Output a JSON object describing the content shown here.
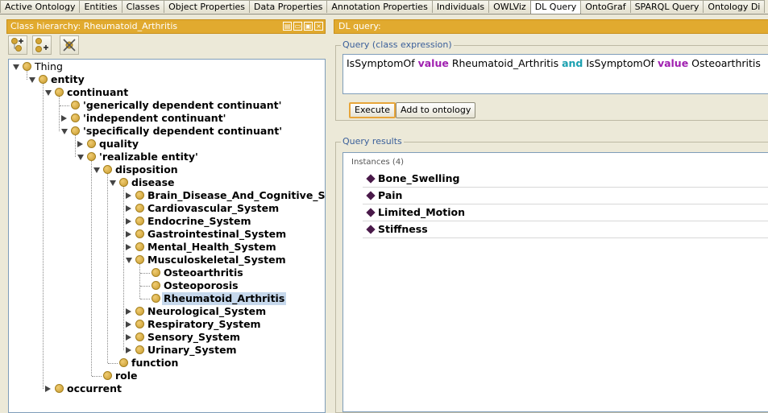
{
  "tabs": [
    {
      "label": "Active Ontology",
      "active": false
    },
    {
      "label": "Entities",
      "active": false
    },
    {
      "label": "Classes",
      "active": false
    },
    {
      "label": "Object Properties",
      "active": false
    },
    {
      "label": "Data Properties",
      "active": false
    },
    {
      "label": "Annotation Properties",
      "active": false
    },
    {
      "label": "Individuals",
      "active": false
    },
    {
      "label": "OWLViz",
      "active": false
    },
    {
      "label": "DL Query",
      "active": true
    },
    {
      "label": "OntoGraf",
      "active": false
    },
    {
      "label": "SPARQL Query",
      "active": false
    },
    {
      "label": "Ontology Di",
      "active": false
    }
  ],
  "class_hierarchy": {
    "title": "Class hierarchy: Rheumatoid_Arthritis",
    "toolbar": [
      {
        "name": "add-subclass-button",
        "icon": "add-subclass-icon"
      },
      {
        "name": "add-sibling-button",
        "icon": "add-sibling-icon"
      },
      {
        "name": "delete-class-button",
        "icon": "delete-class-icon"
      }
    ],
    "nodes": [
      {
        "label": "Thing",
        "depth": 0,
        "state": "open",
        "bold": false
      },
      {
        "label": "entity",
        "depth": 1,
        "state": "open",
        "bold": true
      },
      {
        "label": "continuant",
        "depth": 2,
        "state": "open",
        "bold": true
      },
      {
        "label": "'generically dependent continuant'",
        "depth": 3,
        "state": "leaf",
        "bold": true
      },
      {
        "label": "'independent continuant'",
        "depth": 3,
        "state": "closed",
        "bold": true
      },
      {
        "label": "'specifically dependent continuant'",
        "depth": 3,
        "state": "open",
        "bold": true
      },
      {
        "label": "quality",
        "depth": 4,
        "state": "closed",
        "bold": true
      },
      {
        "label": "'realizable entity'",
        "depth": 4,
        "state": "open",
        "bold": true
      },
      {
        "label": "disposition",
        "depth": 5,
        "state": "open",
        "bold": true
      },
      {
        "label": "disease",
        "depth": 6,
        "state": "open",
        "bold": true
      },
      {
        "label": "Brain_Disease_And_Cognitive_S",
        "depth": 7,
        "state": "closed",
        "bold": true
      },
      {
        "label": "Cardiovascular_System",
        "depth": 7,
        "state": "closed",
        "bold": true
      },
      {
        "label": "Endocrine_System",
        "depth": 7,
        "state": "closed",
        "bold": true
      },
      {
        "label": "Gastrointestinal_System",
        "depth": 7,
        "state": "closed",
        "bold": true
      },
      {
        "label": "Mental_Health_System",
        "depth": 7,
        "state": "closed",
        "bold": true
      },
      {
        "label": "Musculoskeletal_System",
        "depth": 7,
        "state": "open",
        "bold": true
      },
      {
        "label": "Osteoarthritis",
        "depth": 8,
        "state": "leaf",
        "bold": true
      },
      {
        "label": "Osteoporosis",
        "depth": 8,
        "state": "leaf",
        "bold": true
      },
      {
        "label": "Rheumatoid_Arthritis",
        "depth": 8,
        "state": "leaf",
        "bold": true,
        "selected": true
      },
      {
        "label": "Neurological_System",
        "depth": 7,
        "state": "closed",
        "bold": true
      },
      {
        "label": "Respiratory_System",
        "depth": 7,
        "state": "closed",
        "bold": true
      },
      {
        "label": "Sensory_System",
        "depth": 7,
        "state": "closed",
        "bold": true
      },
      {
        "label": "Urinary_System",
        "depth": 7,
        "state": "closed",
        "bold": true
      },
      {
        "label": "function",
        "depth": 6,
        "state": "leaf",
        "bold": true
      },
      {
        "label": "role",
        "depth": 5,
        "state": "leaf",
        "bold": true
      },
      {
        "label": "occurrent",
        "depth": 2,
        "state": "closed",
        "bold": true
      }
    ]
  },
  "dl_query": {
    "title": "DL query:",
    "query_group_label": "Query (class expression)",
    "query_tokens": [
      {
        "text": "IsSymptomOf ",
        "kind": "plain"
      },
      {
        "text": "value",
        "kind": "value"
      },
      {
        "text": " Rheumatoid_Arthritis ",
        "kind": "plain"
      },
      {
        "text": "and",
        "kind": "and"
      },
      {
        "text": " IsSymptomOf ",
        "kind": "plain"
      },
      {
        "text": "value",
        "kind": "value"
      },
      {
        "text": " Osteoarthritis",
        "kind": "plain"
      }
    ],
    "execute_label": "Execute",
    "add_to_ontology_label": "Add to ontology",
    "results_group_label": "Query results",
    "instances_caption": "Instances (4)",
    "instances": [
      "Bone_Swelling",
      "Pain",
      "Limited_Motion",
      "Stiffness"
    ]
  },
  "colors": {
    "header": "#e1aa2f",
    "keyword_value": "#a020b0",
    "keyword_and": "#1aa0b0",
    "selection": "#c6d8ec",
    "individual_diamond": "#4a1a4a"
  }
}
